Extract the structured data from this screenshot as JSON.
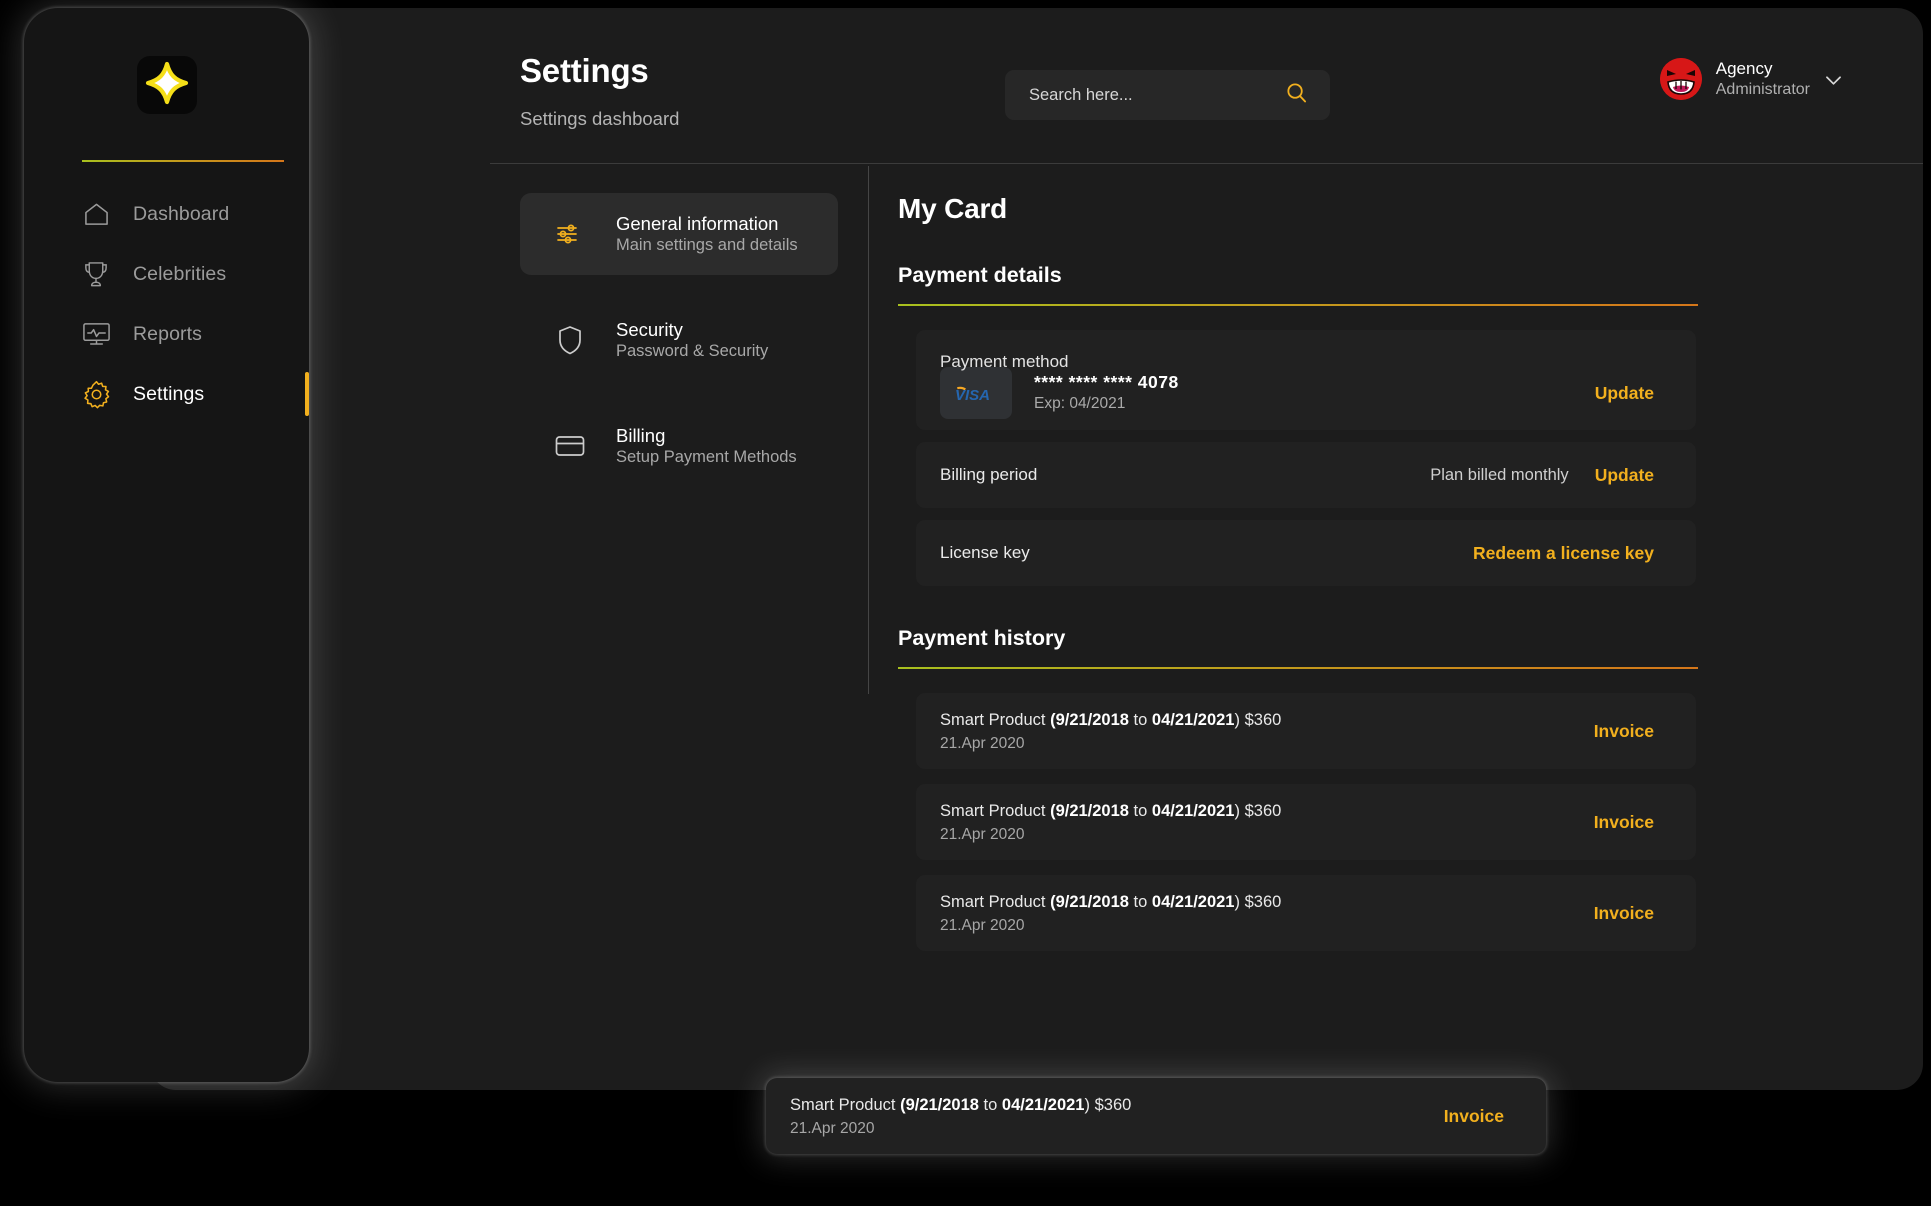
{
  "brand": {
    "logo_icon": "four-point-star-icon",
    "accent": "#f2b01e",
    "gradient_from": "#a8c01e",
    "gradient_to": "#d4761a"
  },
  "sidebar": {
    "items": [
      {
        "label": "Dashboard",
        "icon": "home-icon",
        "active": false
      },
      {
        "label": "Celebrities",
        "icon": "trophy-icon",
        "active": false
      },
      {
        "label": "Reports",
        "icon": "monitor-pulse-icon",
        "active": false
      },
      {
        "label": "Settings",
        "icon": "gear-icon",
        "active": true
      }
    ]
  },
  "header": {
    "title": "Settings",
    "subtitle": "Settings dashboard",
    "search": {
      "placeholder": "Search here...",
      "value": "",
      "icon": "search-icon"
    },
    "user": {
      "name": "Agency",
      "role": "Administrator",
      "avatar_icon": "angry-laughing-face-avatar",
      "chevron": "chevron-down-icon"
    }
  },
  "settings_tabs": [
    {
      "title": "General information",
      "subtitle": "Main settings and details",
      "icon": "sliders-icon",
      "active": true
    },
    {
      "title": "Security",
      "subtitle": "Password & Security",
      "icon": "shield-icon",
      "active": false
    },
    {
      "title": "Billing",
      "subtitle": "Setup Payment Methods",
      "icon": "credit-card-icon",
      "active": false
    }
  ],
  "main": {
    "title": "My Card",
    "payment_details": {
      "heading": "Payment details",
      "payment_method": {
        "label": "Payment method",
        "brand": "VISA",
        "number": "**** **** **** 4078",
        "expiry": "Exp: 04/2021",
        "action": "Update"
      },
      "billing_period": {
        "label": "Billing period",
        "value": "Plan billed monthly",
        "action": "Update"
      },
      "license_key": {
        "label": "License key",
        "action": "Redeem a license key"
      }
    },
    "payment_history": {
      "heading": "Payment history",
      "rows": [
        {
          "product": "Smart Product",
          "range_open": "(",
          "start": "9/21/2018",
          "to": " to ",
          "end": "04/21/2021",
          "range_close": ") ",
          "amount": "$360",
          "date": "21.Apr 2020",
          "action": "Invoice"
        },
        {
          "product": "Smart Product",
          "range_open": "(",
          "start": "9/21/2018",
          "to": " to ",
          "end": "04/21/2021",
          "range_close": ") ",
          "amount": "$360",
          "date": "21.Apr 2020",
          "action": "Invoice"
        },
        {
          "product": "Smart Product",
          "range_open": "(",
          "start": "9/21/2018",
          "to": " to ",
          "end": "04/21/2021",
          "range_close": ") ",
          "amount": "$360",
          "date": "21.Apr 2020",
          "action": "Invoice"
        },
        {
          "product": "Smart Product",
          "range_open": "(",
          "start": "9/21/2018",
          "to": " to ",
          "end": "04/21/2021",
          "range_close": ") ",
          "amount": "$360",
          "date": "21.Apr 2020",
          "action": "Invoice"
        }
      ]
    }
  }
}
